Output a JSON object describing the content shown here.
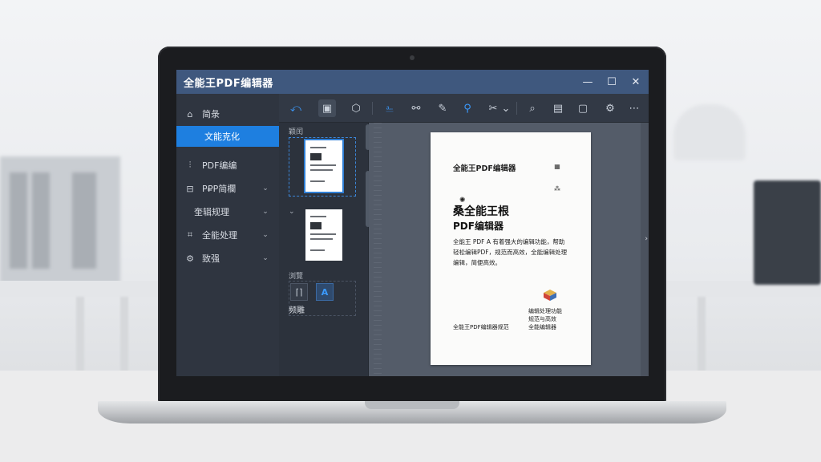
{
  "app": {
    "title": "全能王PDF编辑器"
  },
  "window_controls": {
    "minimize": "—",
    "maximize": "☐",
    "close": "✕"
  },
  "sidebar": {
    "items": [
      {
        "label": "简彔",
        "icon": "home-icon",
        "glyph": "⌂",
        "chevron": ""
      },
      {
        "label": "文能克化",
        "icon": "",
        "glyph": "",
        "chevron": "",
        "active": true
      },
      {
        "label": "PDF编编",
        "icon": "edit-grid-icon",
        "glyph": "⫶",
        "chevron": ""
      },
      {
        "label": "P₽P简欄",
        "icon": "page-icon",
        "glyph": "⊟",
        "chevron": "⌄"
      },
      {
        "label": "奎辑规理",
        "icon": "",
        "glyph": "",
        "chevron": "⌄"
      },
      {
        "label": "全能处理",
        "icon": "tools-icon",
        "glyph": "⌗",
        "chevron": "⌄"
      },
      {
        "label": "致强",
        "icon": "settings-icon",
        "glyph": "⚙",
        "chevron": "⌄"
      }
    ]
  },
  "toolbar": {
    "buttons": [
      {
        "name": "back-icon",
        "glyph": "⤺",
        "blue": true
      },
      {
        "name": "image-icon",
        "glyph": "▣",
        "selected": true
      },
      {
        "name": "shape-icon",
        "glyph": "⬡"
      },
      {
        "name": "select-text-icon",
        "glyph": "⎁",
        "blue": true
      },
      {
        "name": "link-icon",
        "glyph": "⚯"
      },
      {
        "name": "pen-icon",
        "glyph": "✎"
      },
      {
        "name": "search-doc-icon",
        "glyph": "⚲",
        "blue": true
      },
      {
        "name": "crop-icon",
        "glyph": "✂"
      },
      {
        "name": "dropdown-icon",
        "glyph": "⌄"
      },
      {
        "name": "zoom-icon",
        "glyph": "⌕"
      },
      {
        "name": "columns-icon",
        "glyph": "▤"
      },
      {
        "name": "folder-icon",
        "glyph": "▢"
      },
      {
        "name": "gear-icon",
        "glyph": "⚙"
      },
      {
        "name": "more-icon",
        "glyph": "⋯"
      }
    ]
  },
  "thumbnails": {
    "header": "颖闰",
    "section_label": "浏覽",
    "tool_label": "频雕",
    "tool_a_glyph": "⌈⌉",
    "tool_b_glyph": "A",
    "chevron": "⌄"
  },
  "document": {
    "title": "全能王PDF编辑器",
    "heading": "桑全能王根",
    "heading2": "PDF编辑器",
    "body_lines": [
      "全能王 PDF A 有着强大的编辑功能，帮助",
      "轻松编辑PDF，规范而高效，全能编辑处理",
      "编辑，简便高效。"
    ],
    "right_lines": [
      "编辑处理功能",
      "规范与高效",
      "全能编辑器"
    ],
    "footer": "全能王PDF编辑器规范",
    "qr_glyph_1": "▦",
    "qr_glyph_2": "⁂",
    "logo_glyph": "✺",
    "scroll_arrow": "›"
  }
}
